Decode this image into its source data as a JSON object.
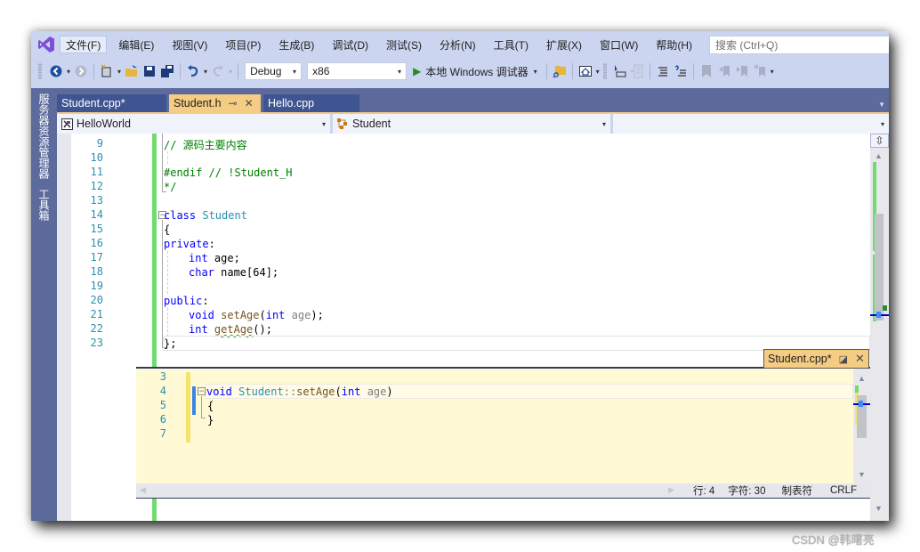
{
  "menubar": {
    "items": [
      "文件(F)",
      "编辑(E)",
      "视图(V)",
      "项目(P)",
      "生成(B)",
      "调试(D)",
      "测试(S)",
      "分析(N)",
      "工具(T)",
      "扩展(X)",
      "窗口(W)",
      "帮助(H)"
    ],
    "active_index": 0,
    "search_placeholder": "搜索 (Ctrl+Q)"
  },
  "toolbar": {
    "configuration": "Debug",
    "platform": "x86",
    "run_label": "本地 Windows 调试器"
  },
  "side_panel": {
    "tabs": [
      "服务器资源管理器",
      "工具箱"
    ]
  },
  "tabs": [
    {
      "label": "Student.cpp*",
      "active": false
    },
    {
      "label": "Student.h",
      "active": true
    },
    {
      "label": "Hello.cpp",
      "active": false
    }
  ],
  "navbar": {
    "project": "HelloWorld",
    "scope": "Student",
    "member": ""
  },
  "editor": {
    "lines": [
      {
        "n": "9"
      },
      {
        "n": "10"
      },
      {
        "n": "11"
      },
      {
        "n": "12"
      },
      {
        "n": "13"
      },
      {
        "n": "14"
      },
      {
        "n": "15"
      },
      {
        "n": "16"
      },
      {
        "n": "17"
      },
      {
        "n": "18"
      },
      {
        "n": "19"
      },
      {
        "n": "20"
      },
      {
        "n": "21"
      },
      {
        "n": "22"
      },
      {
        "n": "23"
      }
    ],
    "code": {
      "l9": "// 源码主要内容",
      "l11": "#endif // !Student_H",
      "l12": "*/",
      "l14_kw": "class",
      "l14_name": "Student",
      "l15": "{",
      "l16_kw": "private",
      "l16_p": ":",
      "l17_kw": "int",
      "l17_p": " age;",
      "l18_kw": "char",
      "l18_p": " name[64];",
      "l20_kw": "public",
      "l20_p": ":",
      "l21_kw": "void",
      "l21_fn": "setAge",
      "l21_p1": "(",
      "l21_kw2": "int",
      "l21_pm": "age",
      "l21_p2": ");",
      "l22_kw": "int",
      "l22_fn": "getAge",
      "l22_p": "();",
      "l23": "};"
    }
  },
  "peek": {
    "tab_label": "Student.cpp*",
    "lines": [
      {
        "n": "3"
      },
      {
        "n": "4"
      },
      {
        "n": "5"
      },
      {
        "n": "6"
      },
      {
        "n": "7"
      }
    ],
    "code": {
      "l4_kw": "void",
      "l4_cls": "Student",
      "l4_sep": "::",
      "l4_fn": "setAge",
      "l4_p1": "(",
      "l4_kw2": "int",
      "l4_pm": "age",
      "l4_p2": ")",
      "l5": "{",
      "l6": "}"
    },
    "status": {
      "line": "行: 4",
      "char": "字符: 30",
      "tabs": "制表符",
      "eol": "CRLF"
    }
  },
  "watermark": "CSDN @韩曙亮"
}
